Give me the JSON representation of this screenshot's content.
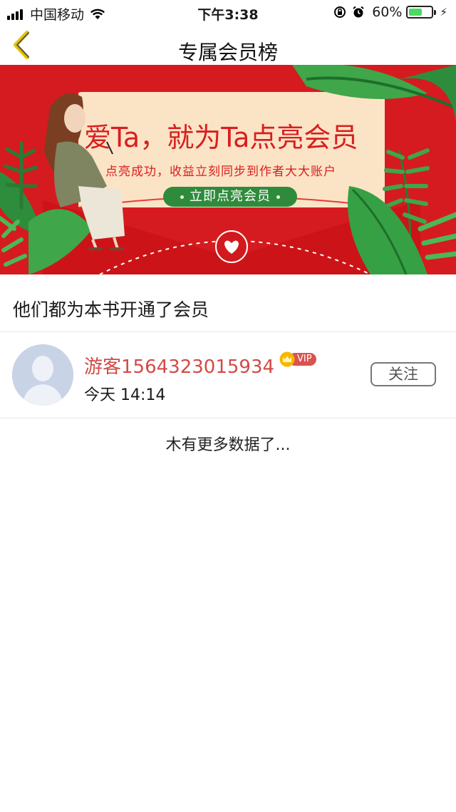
{
  "status_bar": {
    "carrier": "中国移动",
    "time": "下午3:38",
    "battery_percent": "60%",
    "battery_level": 0.6,
    "battery_color": "#4cd964"
  },
  "nav": {
    "back_icon": "chevron-left-icon",
    "title": "专属会员榜"
  },
  "banner": {
    "headline": "爱Ta，就为Ta点亮会员",
    "subtitle": "点亮成功，收益立刻同步到作者大大账户",
    "cta_label": "立即点亮会员",
    "background_color": "#d51b1f",
    "accent_color": "#2f8b3c"
  },
  "section": {
    "title": "他们都为本书开通了会员"
  },
  "members": [
    {
      "name": "游客1564323015934",
      "badge": "VIP",
      "time": "今天 14:14",
      "follow_label": "关注",
      "name_color": "#d24a46"
    }
  ],
  "footer": {
    "no_more_text": "木有更多数据了..."
  }
}
